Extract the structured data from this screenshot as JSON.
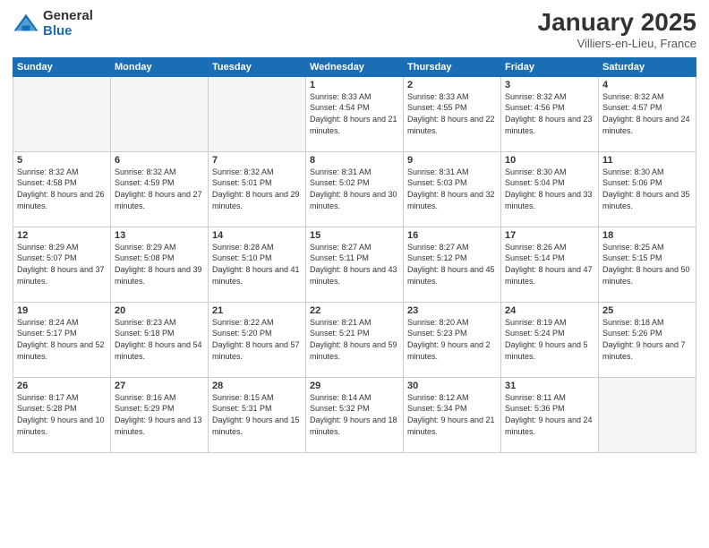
{
  "header": {
    "logo_general": "General",
    "logo_blue": "Blue",
    "month_title": "January 2025",
    "subtitle": "Villiers-en-Lieu, France"
  },
  "weekdays": [
    "Sunday",
    "Monday",
    "Tuesday",
    "Wednesday",
    "Thursday",
    "Friday",
    "Saturday"
  ],
  "weeks": [
    [
      {
        "day": "",
        "empty": true
      },
      {
        "day": "",
        "empty": true
      },
      {
        "day": "",
        "empty": true
      },
      {
        "day": "1",
        "sunrise": "8:33 AM",
        "sunset": "4:54 PM",
        "daylight": "8 hours and 21 minutes."
      },
      {
        "day": "2",
        "sunrise": "8:33 AM",
        "sunset": "4:55 PM",
        "daylight": "8 hours and 22 minutes."
      },
      {
        "day": "3",
        "sunrise": "8:32 AM",
        "sunset": "4:56 PM",
        "daylight": "8 hours and 23 minutes."
      },
      {
        "day": "4",
        "sunrise": "8:32 AM",
        "sunset": "4:57 PM",
        "daylight": "8 hours and 24 minutes."
      }
    ],
    [
      {
        "day": "5",
        "sunrise": "8:32 AM",
        "sunset": "4:58 PM",
        "daylight": "8 hours and 26 minutes."
      },
      {
        "day": "6",
        "sunrise": "8:32 AM",
        "sunset": "4:59 PM",
        "daylight": "8 hours and 27 minutes."
      },
      {
        "day": "7",
        "sunrise": "8:32 AM",
        "sunset": "5:01 PM",
        "daylight": "8 hours and 29 minutes."
      },
      {
        "day": "8",
        "sunrise": "8:31 AM",
        "sunset": "5:02 PM",
        "daylight": "8 hours and 30 minutes."
      },
      {
        "day": "9",
        "sunrise": "8:31 AM",
        "sunset": "5:03 PM",
        "daylight": "8 hours and 32 minutes."
      },
      {
        "day": "10",
        "sunrise": "8:30 AM",
        "sunset": "5:04 PM",
        "daylight": "8 hours and 33 minutes."
      },
      {
        "day": "11",
        "sunrise": "8:30 AM",
        "sunset": "5:06 PM",
        "daylight": "8 hours and 35 minutes."
      }
    ],
    [
      {
        "day": "12",
        "sunrise": "8:29 AM",
        "sunset": "5:07 PM",
        "daylight": "8 hours and 37 minutes."
      },
      {
        "day": "13",
        "sunrise": "8:29 AM",
        "sunset": "5:08 PM",
        "daylight": "8 hours and 39 minutes."
      },
      {
        "day": "14",
        "sunrise": "8:28 AM",
        "sunset": "5:10 PM",
        "daylight": "8 hours and 41 minutes."
      },
      {
        "day": "15",
        "sunrise": "8:27 AM",
        "sunset": "5:11 PM",
        "daylight": "8 hours and 43 minutes."
      },
      {
        "day": "16",
        "sunrise": "8:27 AM",
        "sunset": "5:12 PM",
        "daylight": "8 hours and 45 minutes."
      },
      {
        "day": "17",
        "sunrise": "8:26 AM",
        "sunset": "5:14 PM",
        "daylight": "8 hours and 47 minutes."
      },
      {
        "day": "18",
        "sunrise": "8:25 AM",
        "sunset": "5:15 PM",
        "daylight": "8 hours and 50 minutes."
      }
    ],
    [
      {
        "day": "19",
        "sunrise": "8:24 AM",
        "sunset": "5:17 PM",
        "daylight": "8 hours and 52 minutes."
      },
      {
        "day": "20",
        "sunrise": "8:23 AM",
        "sunset": "5:18 PM",
        "daylight": "8 hours and 54 minutes."
      },
      {
        "day": "21",
        "sunrise": "8:22 AM",
        "sunset": "5:20 PM",
        "daylight": "8 hours and 57 minutes."
      },
      {
        "day": "22",
        "sunrise": "8:21 AM",
        "sunset": "5:21 PM",
        "daylight": "8 hours and 59 minutes."
      },
      {
        "day": "23",
        "sunrise": "8:20 AM",
        "sunset": "5:23 PM",
        "daylight": "9 hours and 2 minutes."
      },
      {
        "day": "24",
        "sunrise": "8:19 AM",
        "sunset": "5:24 PM",
        "daylight": "9 hours and 5 minutes."
      },
      {
        "day": "25",
        "sunrise": "8:18 AM",
        "sunset": "5:26 PM",
        "daylight": "9 hours and 7 minutes."
      }
    ],
    [
      {
        "day": "26",
        "sunrise": "8:17 AM",
        "sunset": "5:28 PM",
        "daylight": "9 hours and 10 minutes."
      },
      {
        "day": "27",
        "sunrise": "8:16 AM",
        "sunset": "5:29 PM",
        "daylight": "9 hours and 13 minutes."
      },
      {
        "day": "28",
        "sunrise": "8:15 AM",
        "sunset": "5:31 PM",
        "daylight": "9 hours and 15 minutes."
      },
      {
        "day": "29",
        "sunrise": "8:14 AM",
        "sunset": "5:32 PM",
        "daylight": "9 hours and 18 minutes."
      },
      {
        "day": "30",
        "sunrise": "8:12 AM",
        "sunset": "5:34 PM",
        "daylight": "9 hours and 21 minutes."
      },
      {
        "day": "31",
        "sunrise": "8:11 AM",
        "sunset": "5:36 PM",
        "daylight": "9 hours and 24 minutes."
      },
      {
        "day": "",
        "empty": true
      }
    ]
  ]
}
